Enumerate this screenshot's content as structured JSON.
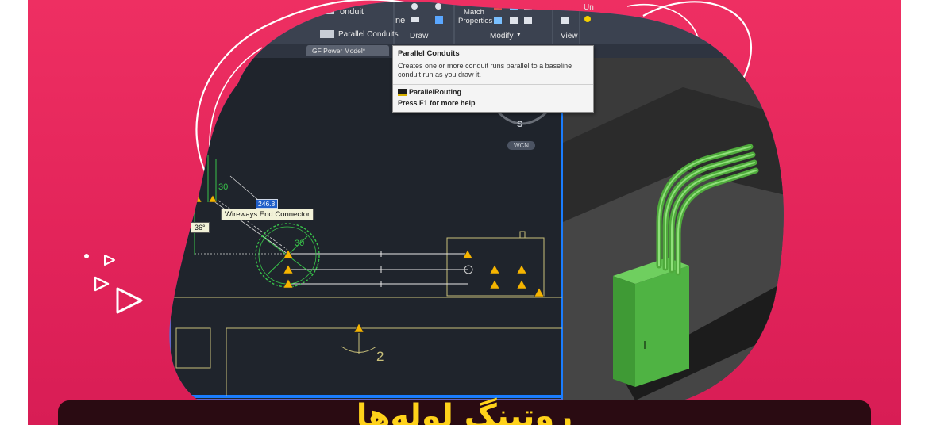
{
  "colors": {
    "background": "#e3245a",
    "blob": "#5f67c8",
    "viewport": "#1f242c",
    "cad_green": "#38c44a",
    "warning_yellow": "#f5b400",
    "banner": "#2a0b12",
    "banner_text": "#ffd21a",
    "highlight_blue": "#1a7dff"
  },
  "ribbon": {
    "conduit_label": "onduit",
    "parallel_conduits_label": "Parallel Conduits",
    "panel_draw": "Draw",
    "panel_modify": "Modify",
    "panel_view": "View",
    "match_properties_line1": "Match",
    "match_properties_line2": "Properties",
    "ne_label": "ne",
    "un_label": "Un"
  },
  "model_tab": {
    "label": "GF Power Model*"
  },
  "tooltip": {
    "title": "Parallel Conduits",
    "description": "Creates one or more conduit runs parallel to a baseline conduit run as you draw it.",
    "command": "ParallelRouting",
    "help": "Press F1 for more help"
  },
  "cad": {
    "connector_tooltip": "Wireways End Connector",
    "dimension_value": "246.8",
    "angle_value": "36°",
    "label_30_top": "30",
    "label_30_circle": "30",
    "label_2": "2",
    "viewcube_s": "S",
    "viewcube_wcn": "WCN"
  },
  "banner": {
    "title": "روتینگ لوله‌ها"
  },
  "icons": [
    "triangle-play-icon",
    "dot-icon",
    "warning-triangle-icon",
    "command-icon"
  ]
}
